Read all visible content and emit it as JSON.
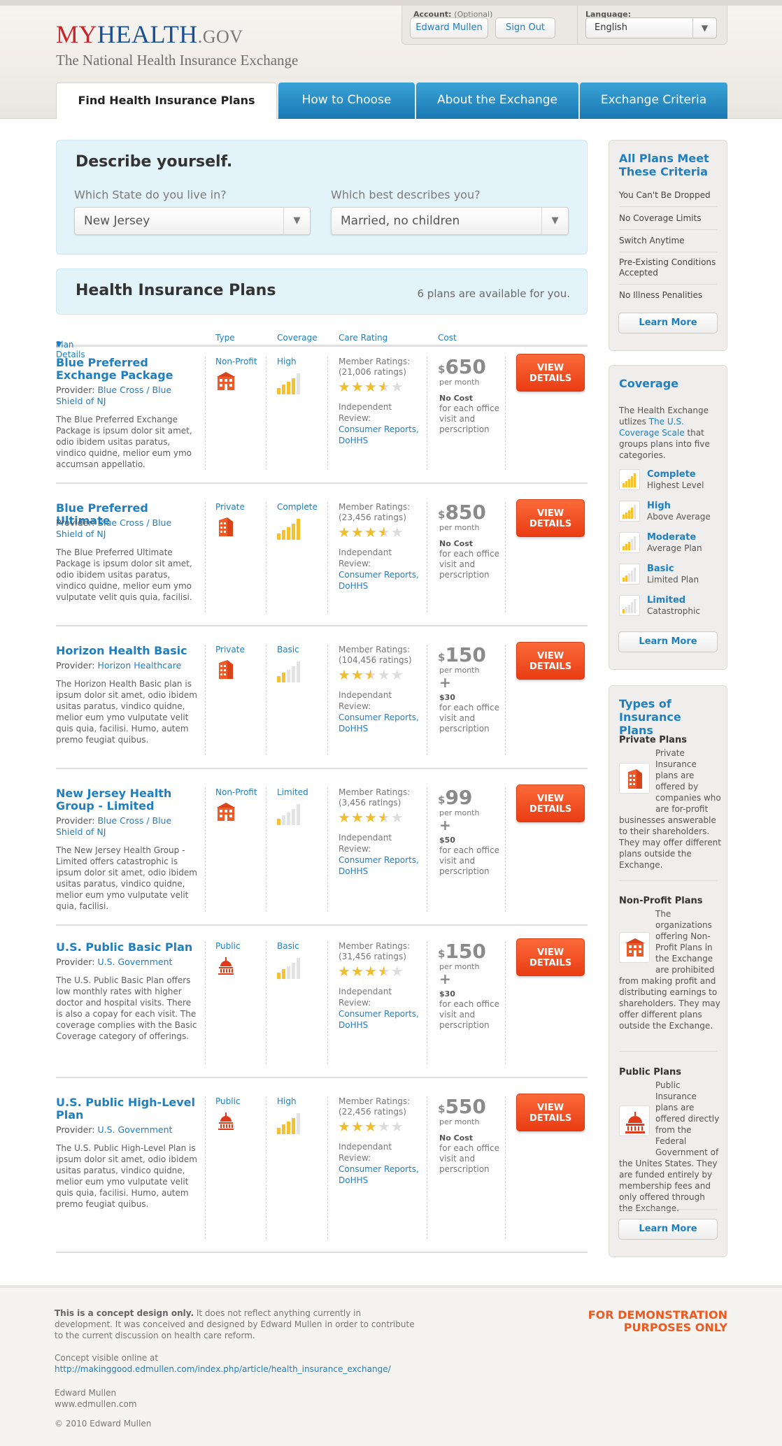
{
  "header": {
    "logo_my": "MY",
    "logo_health": "HEALTH",
    "logo_gov": ".GOV",
    "tagline": "The National Health Insurance Exchange",
    "account_label": "Account:",
    "account_optional": "(Optional)",
    "user_name": "Edward Mullen",
    "sign_out": "Sign Out",
    "language_label": "Language:",
    "language_value": "English"
  },
  "tabs": [
    {
      "label": "Find Health Insurance Plans",
      "active": true
    },
    {
      "label": "How to Choose"
    },
    {
      "label": "About the Exchange"
    },
    {
      "label": "Exchange Criteria"
    }
  ],
  "describe": {
    "title": "Describe yourself.",
    "state_label": "Which State do you live in?",
    "state_value": "New Jersey",
    "status_label": "Which best describes you?",
    "status_value": "Married, no children"
  },
  "plans_header": {
    "title": "Health Insurance Plans",
    "count_text": "6 plans are available for you."
  },
  "columns": {
    "details": "Plan Details",
    "sort_icon": "sort-down-icon",
    "type": "Type",
    "coverage": "Coverage",
    "rating": "Care Rating",
    "cost": "Cost"
  },
  "plans": [
    {
      "name": "Blue Preferred Exchange Package",
      "provider_label": "Provider:",
      "provider": "Blue Cross / Blue Shield of NJ",
      "description": "The Blue Preferred Exchange Package is ipsum dolor sit amet, odio ibidem usitas paratus, vindico quidne, melior eum ymo accumsan appellatio.",
      "type": "Non-Profit",
      "type_icon": "nonprofit-building-icon",
      "coverage": "High",
      "coverage_level": 4,
      "ratings_title": "Member Ratings:",
      "ratings_count": "(21,006 ratings)",
      "stars": 3.5,
      "review_label": "Independent Review:",
      "review_link": "Consumer Reports, DoHHS",
      "price_symbol": "$",
      "price": "650",
      "per": "per month",
      "extra_head": "No Cost",
      "extra_text": "for each office visit and perscription",
      "button": "VIEW DETAILS"
    },
    {
      "name": "Blue Preferred Ultimate",
      "provider_label": "Provider:",
      "provider": "Blue Cross / Blue Shield of NJ",
      "description": "The Blue Preferred Ultimate Package is ipsum dolor sit amet, odio ibidem usitas paratus, vindico quidne, melior eum ymo vulputate velit quis quia, facilisi.",
      "type": "Private",
      "type_icon": "private-building-icon",
      "coverage": "Complete",
      "coverage_level": 5,
      "ratings_title": "Member Ratings:",
      "ratings_count": "(23,456 ratings)",
      "stars": 3.5,
      "review_label": "Independant Review:",
      "review_link": "Consumer Reports, DoHHS",
      "price_symbol": "$",
      "price": "850",
      "per": "per month",
      "extra_head": "No Cost",
      "extra_text": "for each office visit and perscription",
      "button": "VIEW DETAILS"
    },
    {
      "name": "Horizon Health Basic",
      "provider_label": "Provider:",
      "provider": "Horizon Healthcare",
      "description": "The Horizon Health Basic plan is ipsum dolor sit amet, odio ibidem usitas paratus, vindico quidne, melior eum ymo vulputate velit quis quia, facilisi. Humo, autem premo feugiat quibus.",
      "type": "Private",
      "type_icon": "private-building-icon",
      "coverage": "Basic",
      "coverage_level": 2,
      "ratings_title": "Member Ratings:",
      "ratings_count": "(104,456 ratings)",
      "stars": 2.5,
      "review_label": "Independant Review:",
      "review_link": "Consumer Reports, DoHHS",
      "price_symbol": "$",
      "price": "150",
      "per": "per month",
      "plus": "+",
      "extra_head": "$30",
      "extra_text": "for each office visit and perscription",
      "button": "VIEW DETAILS"
    },
    {
      "name": "New Jersey Health Group - Limited",
      "provider_label": "Provider:",
      "provider": "Blue Cross / Blue Shield of NJ",
      "description": "The New Jersey Health Group - Limited offers catastrophic is ipsum dolor sit amet, odio ibidem usitas paratus, vindico quidne, melior eum ymo vulputate velit quia, facilisi.",
      "type": "Non-Profit",
      "type_icon": "nonprofit-building-icon",
      "coverage": "Limited",
      "coverage_level": 1,
      "ratings_title": "Member Ratings:",
      "ratings_count": "(3,456 ratings)",
      "stars": 3.5,
      "review_label": "Independant Review:",
      "review_link": "Consumer Reports, DoHHS",
      "price_symbol": "$",
      "price": "99",
      "per": "per month",
      "plus": "+",
      "extra_head": "$50",
      "extra_text": "for each office visit and perscription",
      "button": "VIEW DETAILS"
    },
    {
      "name": "U.S. Public Basic Plan",
      "provider_label": "Provider:",
      "provider": "U.S. Government",
      "description": "The U.S. Public Basic Plan offers low monthly rates with higher doctor and hospital visits. There is also a copay for each visit. The coverage complies with the Basic Coverage category of offerings.",
      "type": "Public",
      "type_icon": "capitol-dome-icon",
      "coverage": "Basic",
      "coverage_level": 2,
      "ratings_title": "Member Ratings:",
      "ratings_count": "(31,456 ratings)",
      "stars": 3.5,
      "review_label": "Independant Review:",
      "review_link": "Consumer Reports, DoHHS",
      "price_symbol": "$",
      "price": "150",
      "per": "per month",
      "plus": "+",
      "extra_head": "$30",
      "extra_text": "for each office visit and perscription",
      "button": "VIEW DETAILS"
    },
    {
      "name": "U.S. Public High-Level Plan",
      "provider_label": "Provider:",
      "provider": "U.S. Government",
      "description": "The U.S. Public High-Level Plan is ipsum dolor sit amet, odio ibidem usitas paratus, vindico quidne, melior eum ymo vulputate velit quis quia, facilisi. Humo, autem premo feugiat quibus.",
      "type": "Public",
      "type_icon": "capitol-dome-icon",
      "coverage": "High",
      "coverage_level": 4,
      "ratings_title": "Member Ratings:",
      "ratings_count": "(22,456 ratings)",
      "stars": 3,
      "review_label": "Independant Review:",
      "review_link": "Consumer Reports, DoHHS",
      "price_symbol": "$",
      "price": "550",
      "per": "per month",
      "extra_head": "No Cost",
      "extra_text": "for each office visit and perscription",
      "button": "VIEW DETAILS"
    }
  ],
  "sidebar": {
    "criteria": {
      "title": "All Plans Meet These Criteria",
      "items": [
        "You Can't Be Dropped",
        "No Coverage Limits",
        "Switch Anytime",
        "Pre-Existing Conditions Accepted",
        "No Illness Penalities"
      ],
      "button": "Learn More"
    },
    "coverage": {
      "title": "Coverage",
      "text_before": "The Health Exchange utlizes",
      "link": "The U.S. Coverage Scale",
      "text_after": "that groups plans into five categories.",
      "levels": [
        {
          "name": "Complete",
          "desc": "Highest Level",
          "level": 5
        },
        {
          "name": "High",
          "desc": "Above Average",
          "level": 4
        },
        {
          "name": "Moderate",
          "desc": "Average Plan",
          "level": 3
        },
        {
          "name": "Basic",
          "desc": "Limited Plan",
          "level": 2
        },
        {
          "name": "Limited",
          "desc": "Catastrophic",
          "level": 1
        }
      ],
      "button": "Learn More"
    },
    "types": {
      "title": "Types of Insurance Plans",
      "private_title": "Private Plans",
      "private_text": "Private Insurance plans are offered by companies who are for-profit businesses answerable to their shareholders. They may offer different plans outside the Exchange.",
      "nonprofit_title": "Non-Profit Plans",
      "nonprofit_text": "The organizations offering Non-Profit Plans in the Exchange are prohibited from making profit and distributing earnings to shareholders. They may offer different plans outside the Exchange.",
      "public_title": "Public Plans",
      "public_text": "Public Insurance plans are offered directly from the Federal Government of the Unites States. They are funded entirely by membership fees and only offered through the Exchange.",
      "button": "Learn More"
    }
  },
  "footer": {
    "concept_bold": "This is a concept design only.",
    "concept_text": "It does not reflect anything currently in development. It was conceived and designed by Edward Mullen in order to contribute to the current discussion on health care reform.",
    "visible_label": "Concept visible online at",
    "url": "http://makinggood.edmullen.com/index.php/article/health_insurance_exchange/",
    "author": "Edward Mullen",
    "site": "www.edmullen.com",
    "copyright": "© 2010 Edward Mullen",
    "demo_line1": "FOR DEMONSTRATION",
    "demo_line2": "PURPOSES ONLY"
  },
  "colors": {
    "brand_red": "#c8242b",
    "brand_blue": "#1c4f91",
    "link_blue": "#1f7fc0",
    "tab_blue": "#2a8cc6",
    "cta_orange": "#f1581f",
    "star_gold": "#f2bc2a"
  }
}
